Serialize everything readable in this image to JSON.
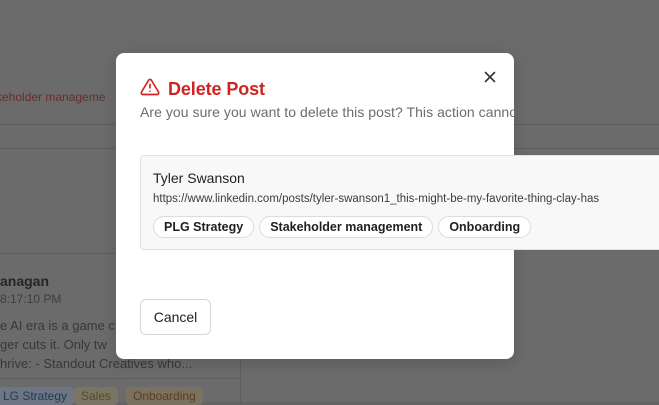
{
  "background": {
    "breadcrumb_fragment": "keholder manageme",
    "author_fragment": "anagan",
    "time_fragment": "8:17:10 PM",
    "snippet_line1_fragment": "e AI era is a game c",
    "snippet_line2_fragment": "ger cuts it. Only tw",
    "snippet_line3_fragment": "hrive: - Standout Creatives who...",
    "tags": [
      {
        "label": "LG Strategy",
        "color": "#6d7682"
      },
      {
        "label": "Sales",
        "color": "#7a7466"
      },
      {
        "label": "Onboarding",
        "color": "#7b7160"
      }
    ]
  },
  "dialog": {
    "title": "Delete Post",
    "description": "Are you sure you want to delete this post? This action cannot be undone.",
    "close_label": "×",
    "cancel_label": "Cancel",
    "icons": {
      "warning": "warning-triangle-icon",
      "close": "close-icon"
    },
    "colors": {
      "danger": "#d22323"
    }
  },
  "post": {
    "author": "Tyler Swanson",
    "url": "https://www.linkedin.com/posts/tyler-swanson1_this-might-be-my-favorite-thing-clay-has",
    "tags": [
      "PLG Strategy",
      "Stakeholder management",
      "Onboarding"
    ]
  }
}
